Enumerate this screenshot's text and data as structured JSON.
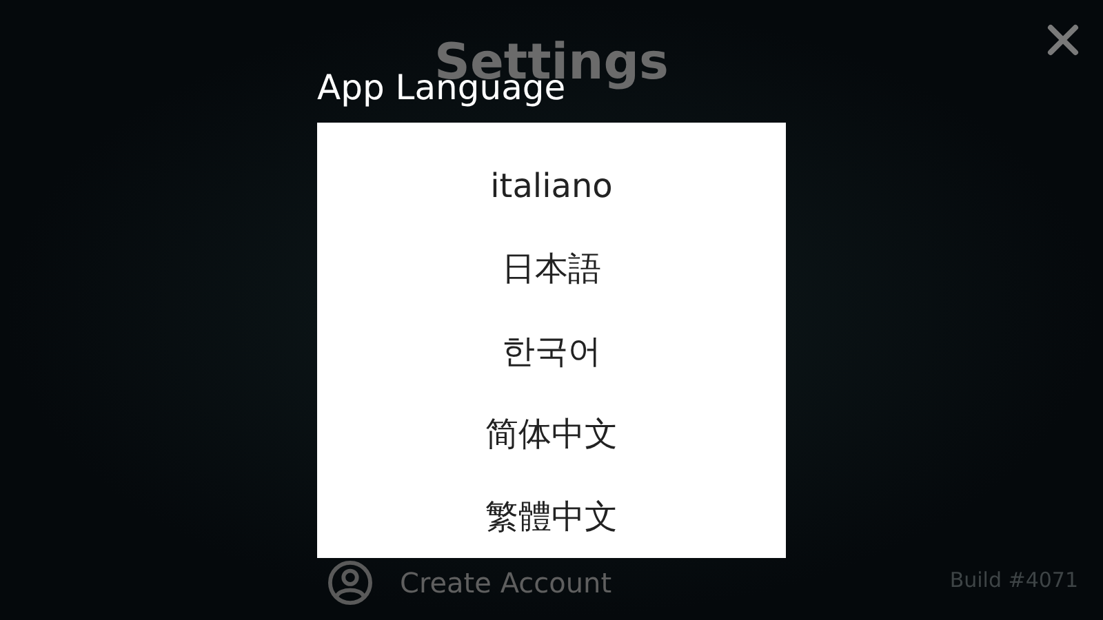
{
  "title": "Settings",
  "account": {
    "label": "Create Account"
  },
  "build": "Build #4071",
  "dialog": {
    "title": "App Language",
    "options": [
      {
        "label": "italiano",
        "selected": false
      },
      {
        "label": "日本語",
        "selected": false
      },
      {
        "label": "한국어",
        "selected": false
      },
      {
        "label": "简体中文",
        "selected": false
      },
      {
        "label": "繁體中文",
        "selected": false
      }
    ]
  }
}
